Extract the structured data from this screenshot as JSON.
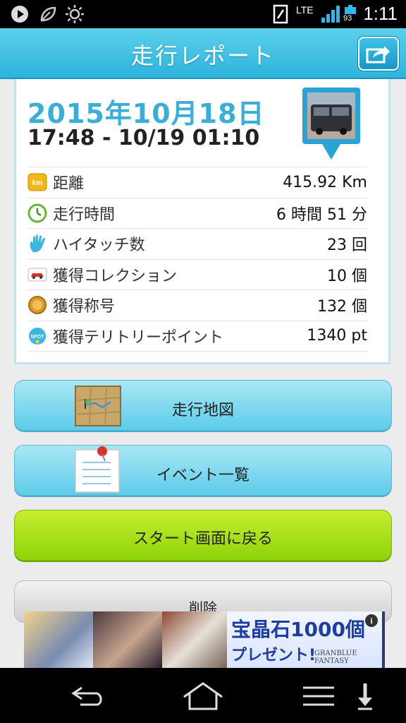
{
  "status_bar": {
    "lte_label": "LTE",
    "battery_level": "93",
    "time": "1:11"
  },
  "header": {
    "title": "走行レポート",
    "share_icon": "share-icon"
  },
  "report": {
    "date": "2015年10月18日",
    "time_range": "17:48 - 10/19 01:10",
    "rows": [
      {
        "icon": "km-icon",
        "label": "距離",
        "value": "415.92 Km"
      },
      {
        "icon": "clock-icon",
        "label": "走行時間",
        "value": "6 時間 51 分"
      },
      {
        "icon": "hand-icon",
        "label": "ハイタッチ数",
        "value": "23 回"
      },
      {
        "icon": "car-icon",
        "label": "獲得コレクション",
        "value": "10 個"
      },
      {
        "icon": "medal-icon",
        "label": "獲得称号",
        "value": "132 個"
      },
      {
        "icon": "spot-icon",
        "label": "獲得テリトリーポイント",
        "value": "1340 pt"
      }
    ],
    "spot_badge": "SPOT",
    "km_badge": "km"
  },
  "buttons": {
    "map": "走行地図",
    "events": "イベント一覧",
    "back_to_start": "スタート画面に戻る",
    "delete": "削除"
  },
  "ad": {
    "headline": "宝晶石1000個",
    "subline": "プレゼント!",
    "brand": "GRANBLUE FANTASY",
    "info": "i"
  },
  "colors": {
    "header": "#2eb3dc",
    "date": "#3aaed6",
    "green_button": "#8fd30a"
  }
}
